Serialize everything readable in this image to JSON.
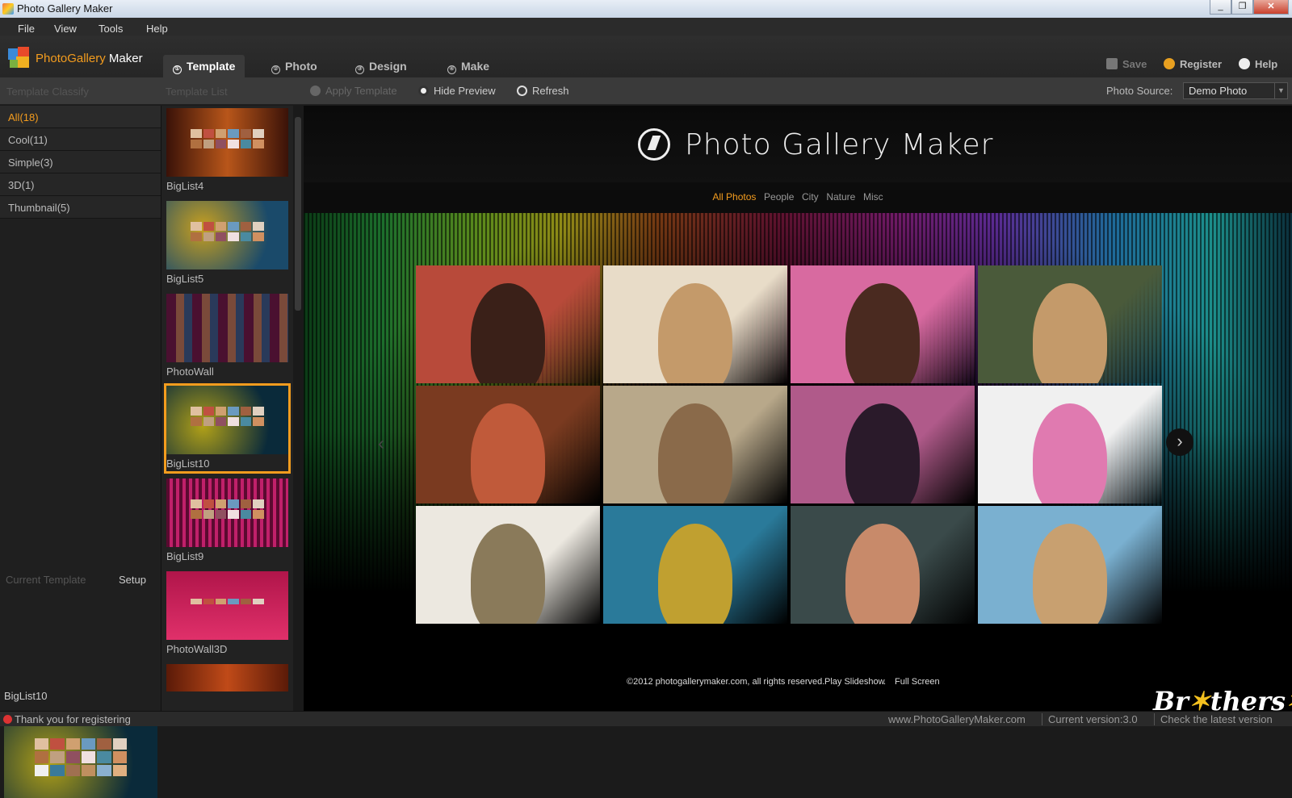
{
  "window": {
    "title": "Photo Gallery Maker",
    "buttons": [
      "_",
      "❐",
      "✕"
    ]
  },
  "menu": [
    "File",
    "View",
    "Tools",
    "Help"
  ],
  "logo": {
    "part1": "PhotoGallery",
    "part2": "Maker"
  },
  "tabs": [
    {
      "label": "Template",
      "icon": "①",
      "active": true
    },
    {
      "label": "Photo",
      "icon": "②",
      "active": false
    },
    {
      "label": "Design",
      "icon": "③",
      "active": false
    },
    {
      "label": "Make",
      "icon": "④",
      "active": false
    }
  ],
  "right_tools": {
    "save": "Save",
    "register": "Register",
    "help": "Help"
  },
  "subbar": {
    "classify_label": "Template Classify",
    "list_label": "Template List",
    "apply": "Apply Template",
    "hide_preview": "Hide Preview",
    "refresh": "Refresh",
    "photo_source_label": "Photo Source:",
    "photo_source_value": "Demo Photo"
  },
  "classify": [
    "All(18)",
    "Cool(11)",
    "Simple(3)",
    "3D(1)",
    "Thumbnail(5)"
  ],
  "current_template": {
    "label": "Current Template",
    "setup": "Setup",
    "name": "BigList10"
  },
  "templates": [
    {
      "name": "BigList4",
      "bg": [
        "#3a1208",
        "#b8561a"
      ]
    },
    {
      "name": "BigList5",
      "bg": [
        "#1a4a6a",
        "#c8a020"
      ]
    },
    {
      "name": "PhotoWall",
      "bg": [
        "#4a1030",
        "#2a1040"
      ]
    },
    {
      "name": "BigList10",
      "bg": [
        "#0a2a3a",
        "#b0a018"
      ]
    },
    {
      "name": "BigList9",
      "bg": [
        "#5a0a30",
        "#c0206a"
      ]
    },
    {
      "name": "PhotoWall3D",
      "bg": [
        "#b0154a",
        "#e0306a"
      ]
    },
    {
      "name": "",
      "bg": [
        "#5a1a08",
        "#c04a18"
      ]
    }
  ],
  "preview": {
    "title": "Photo Gallery Maker",
    "nav": [
      "All Photos",
      "People",
      "City",
      "Nature",
      "Misc"
    ],
    "photos": [
      {
        "bg": "#b84a3a",
        "fig": "#3a2018"
      },
      {
        "bg": "#e8dcc8",
        "fig": "#c49a6a"
      },
      {
        "bg": "#d86aa0",
        "fig": "#4a2a20"
      },
      {
        "bg": "#4a5a3a",
        "fig": "#c49a6a"
      },
      {
        "bg": "#7a3a20",
        "fig": "#c05a3a"
      },
      {
        "bg": "#b8a88a",
        "fig": "#8a6a4a"
      },
      {
        "bg": "#b05a8a",
        "fig": "#2a1a2a"
      },
      {
        "bg": "#f0f0f0",
        "fig": "#e07ab0"
      },
      {
        "bg": "#ece8e0",
        "fig": "#8a7a5a"
      },
      {
        "bg": "#2a7a9a",
        "fig": "#c0a030"
      },
      {
        "bg": "#3a4a4a",
        "fig": "#c88a6a"
      },
      {
        "bg": "#7ab0d0",
        "fig": "#c8a070"
      }
    ],
    "footer": {
      "copyright": "©2012 photogallerymaker.com, all rights reserved.",
      "slideshow": "Play Slideshow",
      "dot": ".",
      "fullscreen": "Full Screen"
    },
    "arrow_left": "‹",
    "arrow_right": "›"
  },
  "status": {
    "message": "Thank you for registering",
    "url": "www.PhotoGalleryMaker.com",
    "version": "Current version:3.0",
    "check": "Check the latest version"
  },
  "watermark": "Brothersoft",
  "colors": {
    "accent": "#f39c1e"
  }
}
